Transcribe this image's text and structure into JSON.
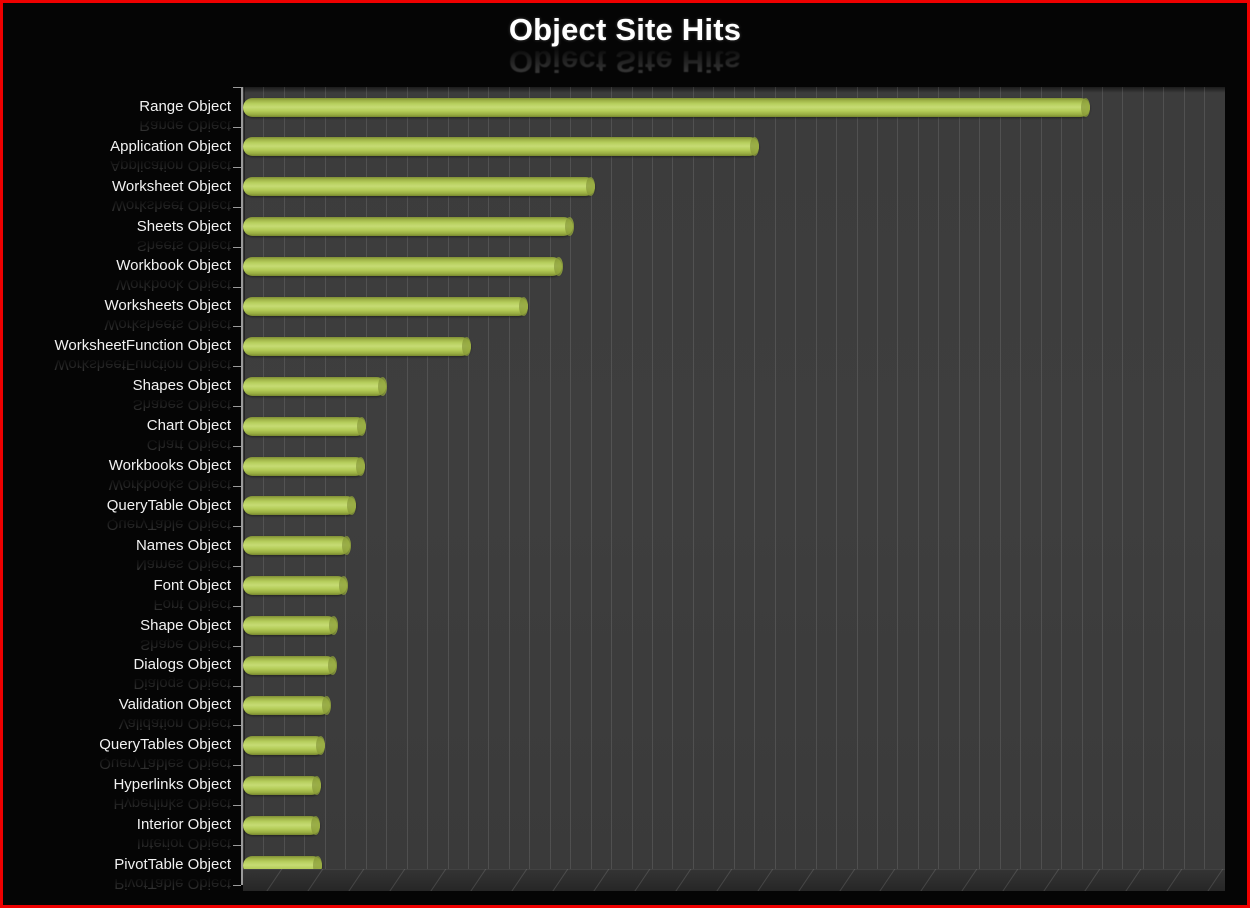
{
  "chart_data": {
    "type": "bar",
    "orientation": "horizontal",
    "title": "Object Site Hits",
    "xlabel": "",
    "ylabel": "",
    "grid": true,
    "legend": false,
    "axis_tick_labels": [],
    "categories": [
      "Range Object",
      "Application Object",
      "Worksheet Object",
      "Sheets Object",
      "Workbook Object",
      "Worksheets Object",
      "WorksheetFunction Object",
      "Shapes Object",
      "Chart Object",
      "Workbooks Object",
      "QueryTable Object",
      "Names Object",
      "Font Object",
      "Shape Object",
      "Dialogs Object",
      "Validation Object",
      "QueryTables Object",
      "Hyperlinks Object",
      "Interior Object",
      "PivotTable Object"
    ],
    "values": [
      862,
      525,
      358,
      336,
      325,
      290,
      232,
      146,
      125,
      124,
      115,
      109,
      106,
      96,
      95,
      89,
      83,
      79,
      78,
      80
    ],
    "value_unit": "hits",
    "xlim": [
      0,
      1000
    ],
    "bar_color": "#b7cf5e"
  },
  "style": {
    "border_color": "#ee0000",
    "background_color": "#050505",
    "plot_background_color": "#3d3d3d",
    "gridline_color": "#6e6e6e",
    "axis_color": "#9a9a9a",
    "title_color": "#ffffff",
    "label_color": "#f2f2f2"
  },
  "icons": {
    "reflection": "mirror-reflection-effect"
  }
}
